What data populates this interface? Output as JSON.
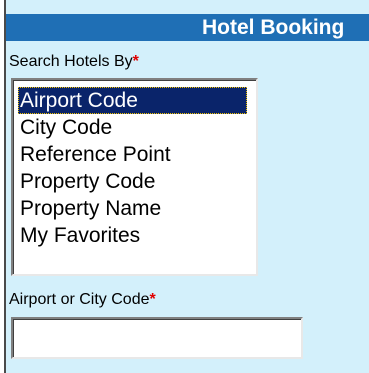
{
  "header": {
    "title": "Hotel Booking"
  },
  "search_by": {
    "label": "Search Hotels By",
    "required_mark": "*",
    "options": [
      {
        "label": "Airport Code",
        "selected": true
      },
      {
        "label": "City Code",
        "selected": false
      },
      {
        "label": "Reference Point",
        "selected": false
      },
      {
        "label": "Property Code",
        "selected": false
      },
      {
        "label": "Property Name",
        "selected": false
      },
      {
        "label": "My Favorites",
        "selected": false
      }
    ]
  },
  "code_field": {
    "label": "Airport or City Code",
    "required_mark": "*",
    "value": "",
    "placeholder": ""
  },
  "colors": {
    "background": "#d3f0fb",
    "header": "#1f6fb5",
    "selection": "#0a246a",
    "required": "#e00000"
  }
}
